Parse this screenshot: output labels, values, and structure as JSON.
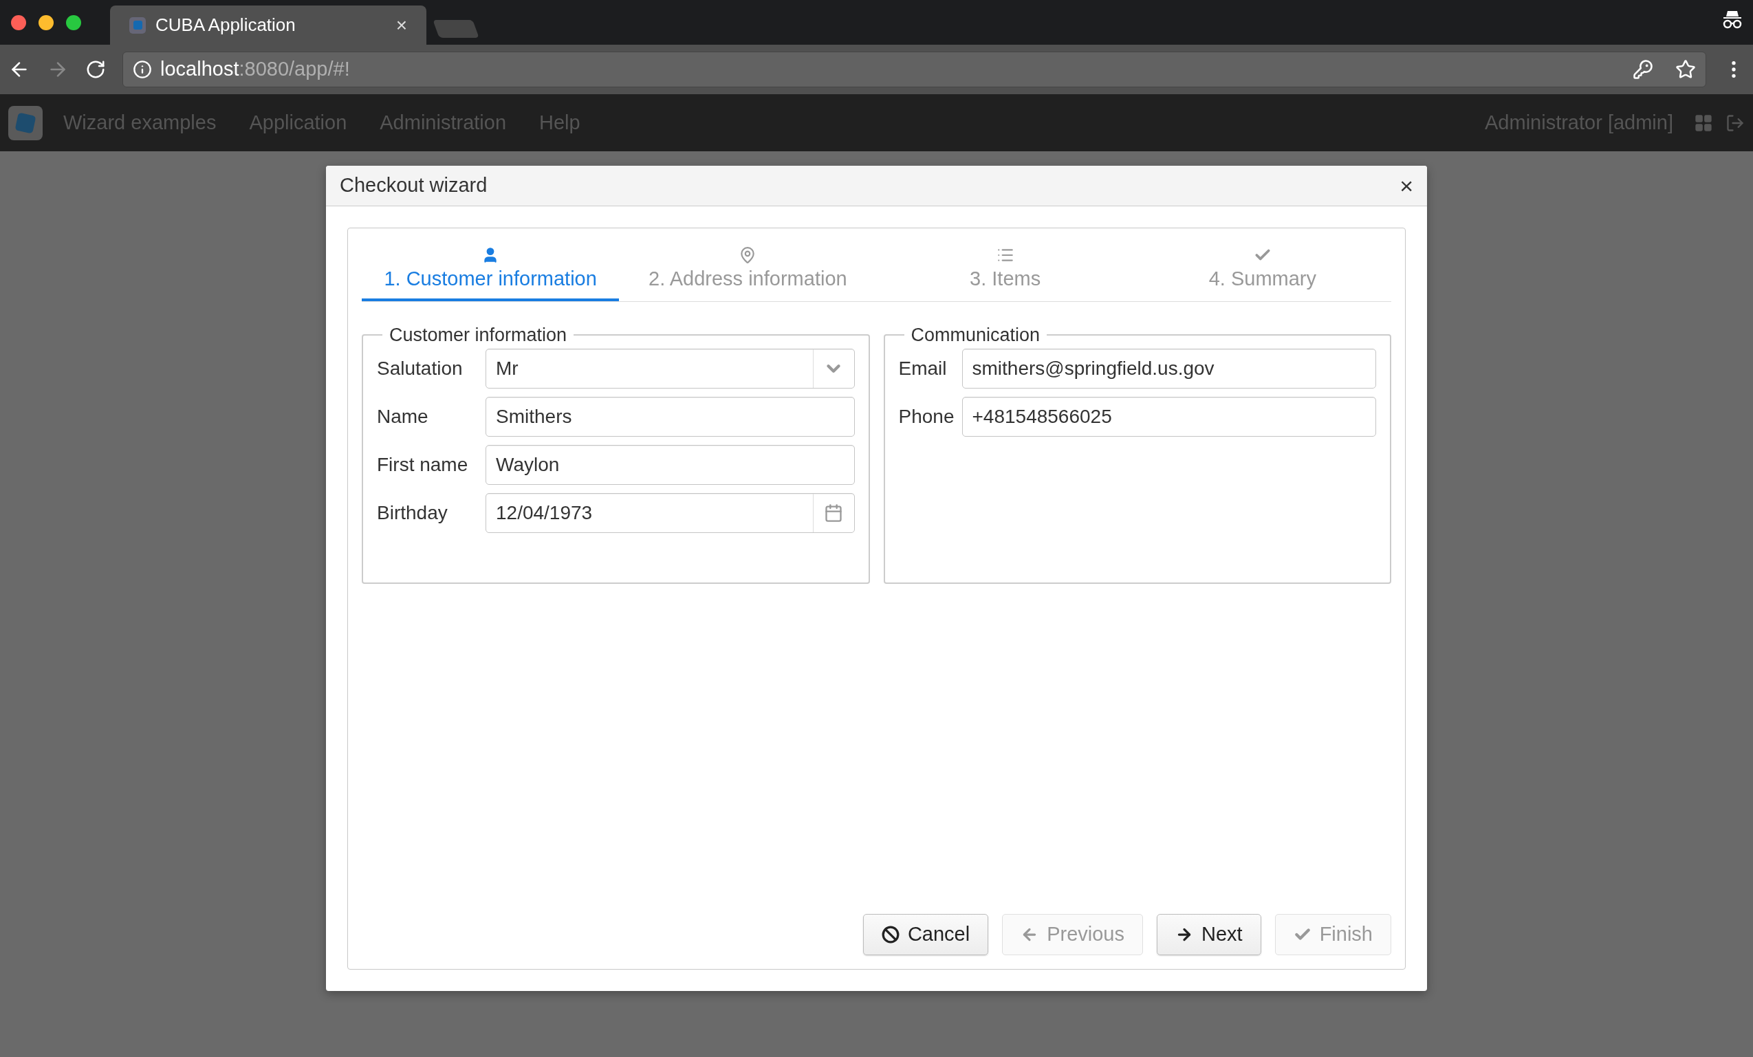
{
  "browser": {
    "tab_title": "CUBA Application",
    "tab_close": "×",
    "url_host": "localhost",
    "url_path": ":8080/app/#!"
  },
  "app_menu": {
    "items": [
      "Wizard examples",
      "Application",
      "Administration",
      "Help"
    ],
    "user": "Administrator [admin]"
  },
  "dialog": {
    "title": "Checkout wizard",
    "close": "×",
    "steps": [
      {
        "label": "1. Customer information",
        "kind": "user",
        "selected": true
      },
      {
        "label": "2. Address information",
        "kind": "pin",
        "selected": false
      },
      {
        "label": "3. Items",
        "kind": "list",
        "selected": false
      },
      {
        "label": "4. Summary",
        "kind": "check",
        "selected": false
      }
    ],
    "groups": [
      {
        "caption": "Customer information",
        "fields": [
          {
            "label": "Salutation",
            "value": "Mr",
            "kind": "select"
          },
          {
            "label": "Name",
            "value": "Smithers",
            "kind": "text"
          },
          {
            "label": "First name",
            "value": "Waylon",
            "kind": "text"
          },
          {
            "label": "Birthday",
            "value": "12/04/1973",
            "kind": "date"
          }
        ]
      },
      {
        "caption": "Communication",
        "fields": [
          {
            "label": "Email",
            "value": "smithers@springfield.us.gov",
            "kind": "text"
          },
          {
            "label": "Phone",
            "value": "+481548566025",
            "kind": "text"
          }
        ]
      }
    ],
    "buttons": [
      {
        "label": "Cancel",
        "kind": "cancel",
        "disabled": false
      },
      {
        "label": "Previous",
        "kind": "previous",
        "disabled": true
      },
      {
        "label": "Next",
        "kind": "next",
        "disabled": false
      },
      {
        "label": "Finish",
        "kind": "finish",
        "disabled": true
      }
    ]
  }
}
